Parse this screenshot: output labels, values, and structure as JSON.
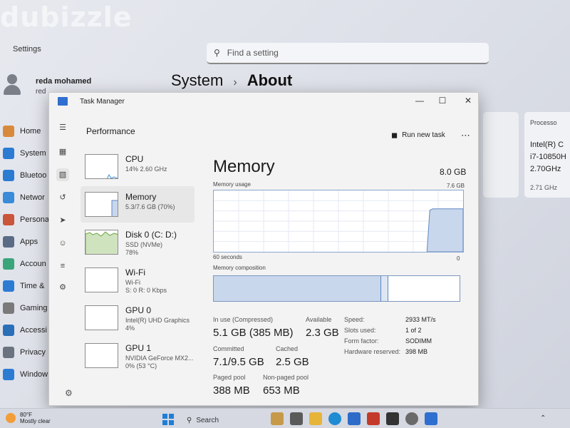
{
  "watermark": "dubizzle",
  "settings": {
    "title": "Settings",
    "search_placeholder": "Find a setting",
    "user_name": "reda mohamed",
    "user_sub": "red",
    "breadcrumb": [
      "System",
      "About"
    ],
    "nav": [
      {
        "label": "Home",
        "icon": "home-icon",
        "color": "#d88a3c"
      },
      {
        "label": "System",
        "icon": "monitor-icon",
        "color": "#2c7bd3"
      },
      {
        "label": "Bluetoo",
        "icon": "bluetooth-icon",
        "color": "#2c7bd3"
      },
      {
        "label": "Networ",
        "icon": "wifi-icon",
        "color": "#3a8bd8"
      },
      {
        "label": "Persona",
        "icon": "brush-icon",
        "color": "#c9553b"
      },
      {
        "label": "Apps",
        "icon": "apps-icon",
        "color": "#5a6b86"
      },
      {
        "label": "Accoun",
        "icon": "person-icon",
        "color": "#3aa57a"
      },
      {
        "label": "Time &",
        "icon": "globe-clock-icon",
        "color": "#2c7bd3"
      },
      {
        "label": "Gaming",
        "icon": "gamepad-icon",
        "color": "#7a7a7a"
      },
      {
        "label": "Accessi",
        "icon": "accessibility-icon",
        "color": "#2a6fb8"
      },
      {
        "label": "Privacy",
        "icon": "shield-icon",
        "color": "#6b7280"
      },
      {
        "label": "Window",
        "icon": "windows-update-icon",
        "color": "#2c7bd3"
      }
    ],
    "processor_card": {
      "title": "Processo",
      "value_lines": [
        "Intel(R) C",
        "i7-10850H",
        "2.70GHz"
      ],
      "speed": "2.71 GHz"
    }
  },
  "taskmanager": {
    "title": "Task Manager",
    "section": "Performance",
    "run_new_task": "Run new task",
    "more_icon": "more-icon",
    "items": [
      {
        "name": "CPU",
        "sub": [
          "14%  2.60 GHz"
        ],
        "kind": "cpu"
      },
      {
        "name": "Memory",
        "sub": [
          "5.3/7.6 GB (70%)"
        ],
        "kind": "memory"
      },
      {
        "name": "Disk 0 (C: D:)",
        "sub": [
          "SSD (NVMe)",
          "78%"
        ],
        "kind": "disk"
      },
      {
        "name": "Wi-Fi",
        "sub": [
          "Wi-Fi",
          "S: 0  R: 0 Kbps"
        ],
        "kind": "wifi"
      },
      {
        "name": "GPU 0",
        "sub": [
          "Intel(R) UHD Graphics",
          "4%"
        ],
        "kind": "gpu"
      },
      {
        "name": "GPU 1",
        "sub": [
          "NVIDIA GeForce MX2...",
          "0% (53 °C)"
        ],
        "kind": "gpu"
      }
    ],
    "memory": {
      "title": "Memory",
      "total": "8.0 GB",
      "usage_label": "Memory usage",
      "usage_max": "7.6 GB",
      "time_label": "60 seconds",
      "zero_label": "0",
      "composition_label": "Memory composition",
      "usage_fraction": 0.7,
      "in_use_fraction": 0.68,
      "modified_fraction": 0.03,
      "stats": {
        "in_use_label": "In use (Compressed)",
        "in_use_value": "5.1 GB (385 MB)",
        "available_label": "Available",
        "available_value": "2.3 GB",
        "committed_label": "Committed",
        "committed_value": "7.1/9.5 GB",
        "cached_label": "Cached",
        "cached_value": "2.5 GB",
        "paged_label": "Paged pool",
        "paged_value": "388 MB",
        "nonpaged_label": "Non-paged pool",
        "nonpaged_value": "653 MB"
      },
      "hardware": [
        {
          "label": "Speed:",
          "value": "2933 MT/s"
        },
        {
          "label": "Slots used:",
          "value": "1 of 2"
        },
        {
          "label": "Form factor:",
          "value": "SODIMM"
        },
        {
          "label": "Hardware reserved:",
          "value": "398 MB"
        }
      ]
    }
  },
  "taskbar": {
    "weather_temp": "80°F",
    "weather_desc": "Mostly clear",
    "search_label": "Search"
  },
  "colors": {
    "graph_fill": "#c9d7ec",
    "graph_line": "#5f87c4",
    "accent": "#2f6fd0"
  }
}
